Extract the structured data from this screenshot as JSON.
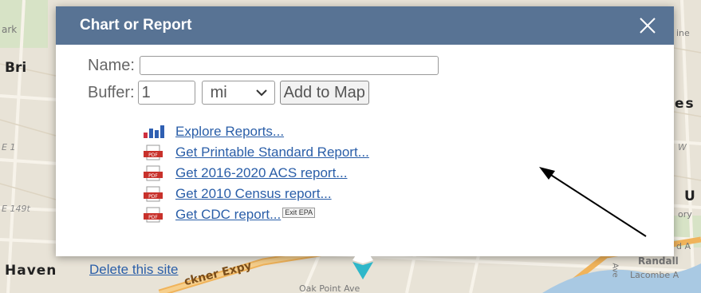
{
  "map": {
    "labels": {
      "bri": "Bri",
      "ark": "ark",
      "e1": "E 1",
      "e149": "E 149t",
      "haven": "Haven",
      "expressway": "ckner Expy",
      "oak_point": "Oak Point Ave",
      "es": "es",
      "u": "U",
      "ory": "ory",
      "w": "W",
      "ne": "ine",
      "da": "d A",
      "randall": "Randall",
      "lacombe": "Lacombe A",
      "ave": "Ave"
    }
  },
  "dialog": {
    "title": "Chart or Report",
    "name_label": "Name:",
    "name_value": "",
    "buffer_label": "Buffer:",
    "buffer_value": "1",
    "unit_selected": "mi",
    "add_button": "Add to Map",
    "links": [
      {
        "label": "Explore Reports...",
        "icon": "bar-chart-icon"
      },
      {
        "label": "Get Printable Standard Report...",
        "icon": "pdf-icon"
      },
      {
        "label": "Get 2016-2020 ACS report...",
        "icon": "pdf-icon"
      },
      {
        "label": "Get 2010 Census report...",
        "icon": "pdf-icon"
      },
      {
        "label": "Get CDC report...",
        "icon": "pdf-icon"
      }
    ],
    "exit_badge": "Exit EPA",
    "delete_link": "Delete this site"
  },
  "colors": {
    "header": "#587394",
    "link": "#2a5ea8",
    "map_bg": "#e8e3d7",
    "pin": "#2fb7c9",
    "pdf_icon": "#c8312b"
  }
}
